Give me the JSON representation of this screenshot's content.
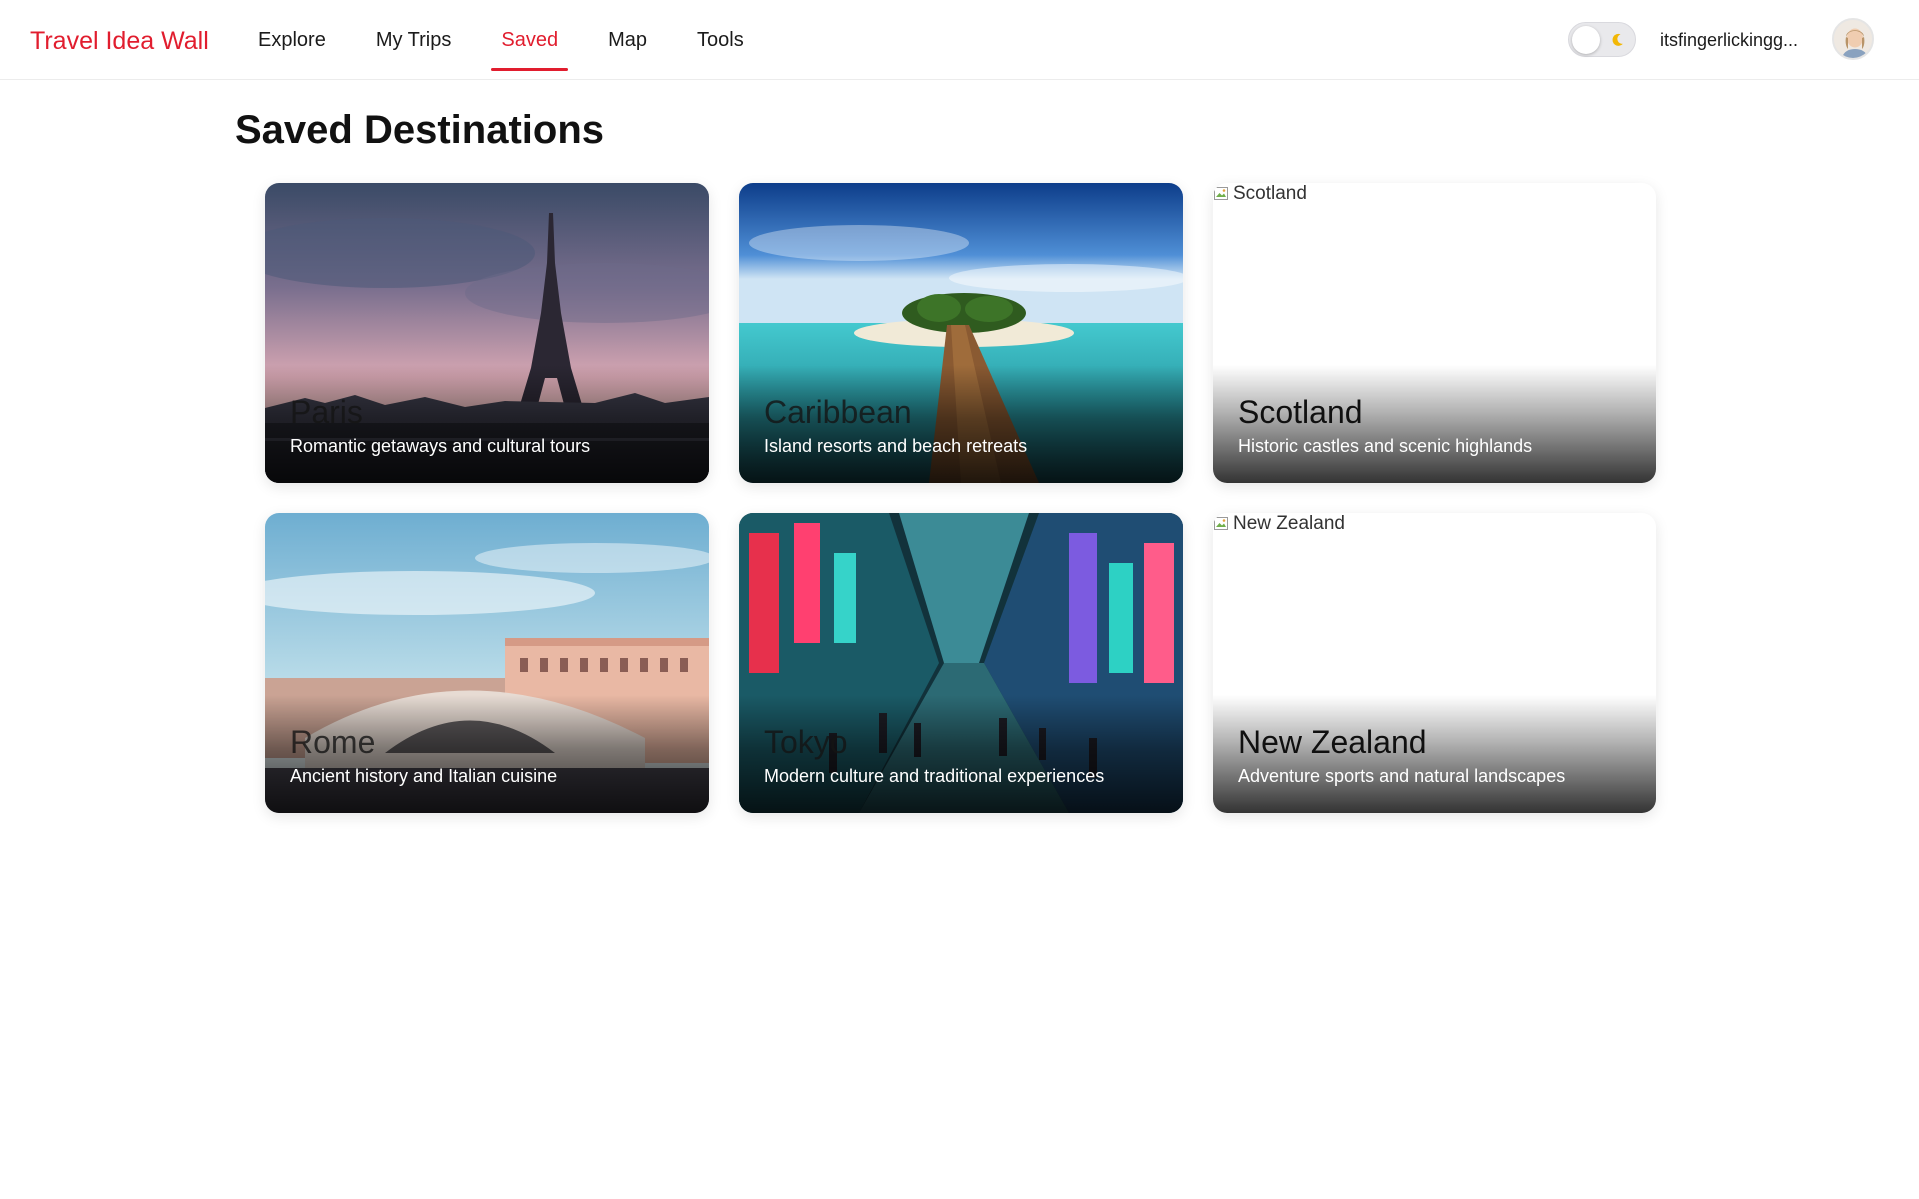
{
  "app": {
    "brand": "Travel Idea Wall"
  },
  "nav": {
    "items": [
      {
        "label": "Explore",
        "active": false
      },
      {
        "label": "My Trips",
        "active": false
      },
      {
        "label": "Saved",
        "active": true
      },
      {
        "label": "Map",
        "active": false
      },
      {
        "label": "Tools",
        "active": false
      }
    ]
  },
  "header": {
    "theme_toggle": {
      "state": "off",
      "icon": "moon-icon"
    },
    "username": "itsfingerlickingg...",
    "avatar_icon": "avatar"
  },
  "main": {
    "title": "Saved Destinations",
    "destinations": [
      {
        "name": "Paris",
        "description": "Romantic getaways and cultural tours",
        "image_loaded": true
      },
      {
        "name": "Caribbean",
        "description": "Island resorts and beach retreats",
        "image_loaded": true
      },
      {
        "name": "Scotland",
        "description": "Historic castles and scenic highlands",
        "image_loaded": false,
        "alt": "Scotland"
      },
      {
        "name": "Rome",
        "description": "Ancient history and Italian cuisine",
        "image_loaded": true
      },
      {
        "name": "Tokyo",
        "description": "Modern culture and traditional experiences",
        "image_loaded": true
      },
      {
        "name": "New Zealand",
        "description": "Adventure sports and natural landscapes",
        "image_loaded": false,
        "alt": "New Zealand"
      }
    ]
  },
  "colors": {
    "accent": "#e11d2e",
    "text": "#111111",
    "header_border": "#ececec"
  }
}
